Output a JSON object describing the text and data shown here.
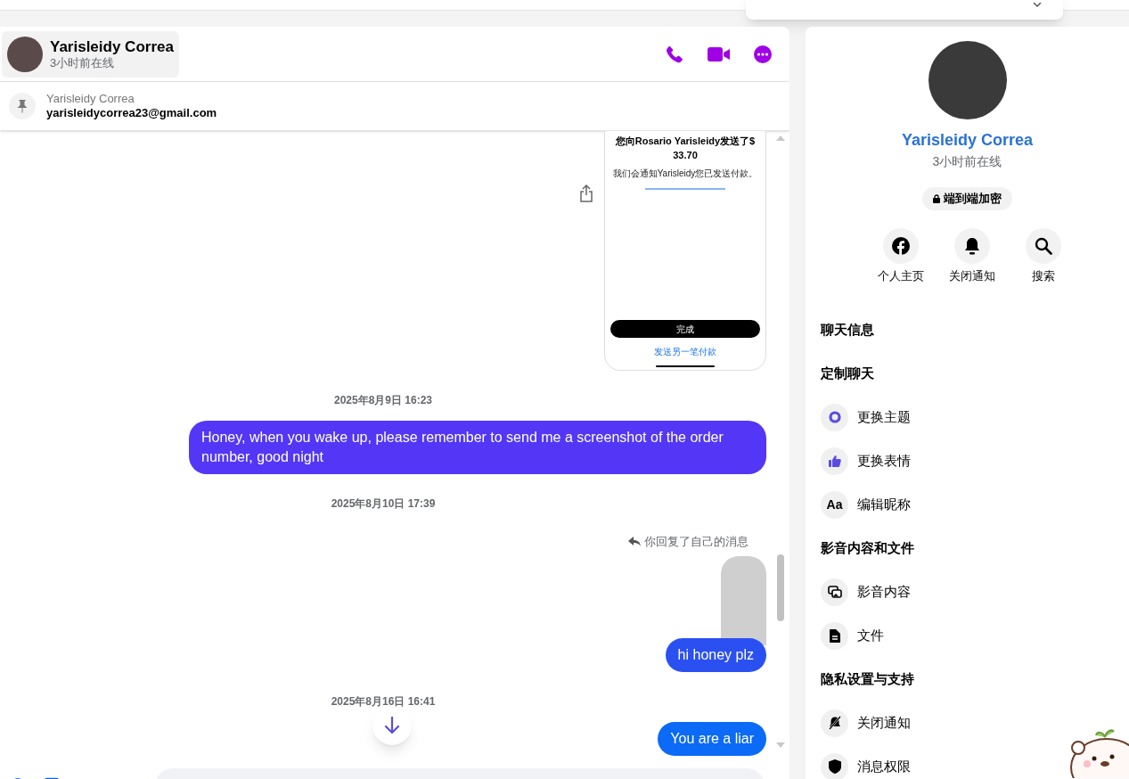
{
  "chat": {
    "header": {
      "name": "Yarisleidy Correa",
      "status": "3小时前在线"
    },
    "pinned": {
      "sender": "Yarisleidy Correa",
      "text": "yarisleidycorrea23@gmail.com"
    },
    "messages": [
      {
        "kind": "payment_screenshot",
        "title": "您向**Rosario Yarisleidy**发送了$ 33.70",
        "note": "我们会通知Yarisleidy您已发送付款。",
        "button": "完成",
        "link": "发送另一笔付款"
      },
      {
        "kind": "timestamp",
        "text": "2025年8月9日 16:23"
      },
      {
        "kind": "outgoing",
        "text": "Honey, when you wake up, please remember to send me a screenshot of the order number, good night",
        "color": "#5436f6"
      },
      {
        "kind": "timestamp",
        "text": "2025年8月10日 17:39"
      },
      {
        "kind": "reply_note",
        "text": "你回复了自己的消息"
      },
      {
        "kind": "reply_image"
      },
      {
        "kind": "outgoing",
        "text": "hi honey plz",
        "color": "#2b50f2"
      },
      {
        "kind": "timestamp",
        "text": "2025年8月16日 16:41"
      },
      {
        "kind": "outgoing",
        "text": "You are a liar",
        "color": "#0b6af6"
      }
    ]
  },
  "profile": {
    "name": "Yarisleidy Correa",
    "status": "3小时前在线",
    "encryption": "端到端加密",
    "actions": [
      {
        "kind": "profile",
        "label": "个人主页"
      },
      {
        "kind": "mute",
        "label": "关闭通知"
      },
      {
        "kind": "search",
        "label": "搜索"
      }
    ],
    "sections": [
      {
        "heading": "聊天信息"
      },
      {
        "heading": "定制聊天",
        "items": [
          {
            "kind": "theme",
            "label": "更换主题"
          },
          {
            "kind": "emoji",
            "label": "更换表情"
          },
          {
            "kind": "nickname",
            "icon_text": "Aa",
            "label": "编辑昵称"
          }
        ]
      },
      {
        "heading": "影音内容和文件",
        "items": [
          {
            "kind": "media",
            "label": "影音内容"
          },
          {
            "kind": "file",
            "label": "文件"
          }
        ]
      },
      {
        "heading": "隐私设置与支持",
        "items": [
          {
            "kind": "mute",
            "label": "关闭通知"
          },
          {
            "kind": "shield",
            "label": "消息权限"
          }
        ]
      }
    ]
  }
}
